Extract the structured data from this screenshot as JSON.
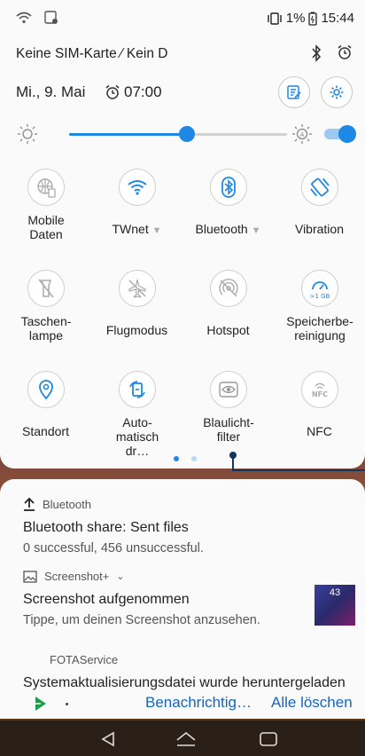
{
  "status_bar": {
    "battery_text": "1%",
    "time": "15:44"
  },
  "carrier": "Keine SIM-Karte ⁄ Kein D",
  "date_row": {
    "date": "Mi., 9. Mai",
    "alarm_time": "07:00"
  },
  "brightness": {
    "level": 0.54,
    "auto_enabled": true
  },
  "tiles": [
    {
      "label": "Mobile Daten",
      "icon": "globe-mobile-data-icon",
      "active": false
    },
    {
      "label": "TWnet",
      "icon": "wifi-icon",
      "active": true,
      "has_dropdown": true
    },
    {
      "label": "Bluetooth",
      "icon": "bluetooth-icon",
      "active": true,
      "has_dropdown": true
    },
    {
      "label": "Vibration",
      "icon": "vibration-icon",
      "active": true
    },
    {
      "label": "Taschen-lampe",
      "icon": "flashlight-icon",
      "active": false
    },
    {
      "label": "Flugmodus",
      "icon": "airplane-icon",
      "active": false
    },
    {
      "label": "Hotspot",
      "icon": "hotspot-icon",
      "active": false
    },
    {
      "label": "Speicherbe-reinigung",
      "icon": "memory-boost-icon",
      "active": true,
      "badge": ">1 GB"
    },
    {
      "label": "Standort",
      "icon": "location-icon",
      "active": true
    },
    {
      "label": "Auto-matisch dr…",
      "icon": "auto-rotate-icon",
      "active": true
    },
    {
      "label": "Blaulicht-filter",
      "icon": "bluelight-filter-icon",
      "active": false
    },
    {
      "label": "NFC",
      "icon": "nfc-icon",
      "active": false,
      "badge": "NFC"
    }
  ],
  "notifications": [
    {
      "app": "Bluetooth",
      "title": "Bluetooth share: Sent files",
      "body": "0 successful, 456 unsuccessful."
    },
    {
      "app": "Screenshot+",
      "title": "Screenshot aufgenommen",
      "body": "Tippe, um deinen Screenshot anzusehen."
    },
    {
      "app": "FOTAService",
      "title": "Systemaktualisierungsdatei wurde heruntergeladen",
      "body": ""
    }
  ],
  "screenshot_thumb_text": "43",
  "actions": {
    "notification_settings": "Benachrichtig…",
    "clear_all": "Alle löschen"
  },
  "colors": {
    "accent": "#1e88e5",
    "action_text": "#1565c0"
  }
}
